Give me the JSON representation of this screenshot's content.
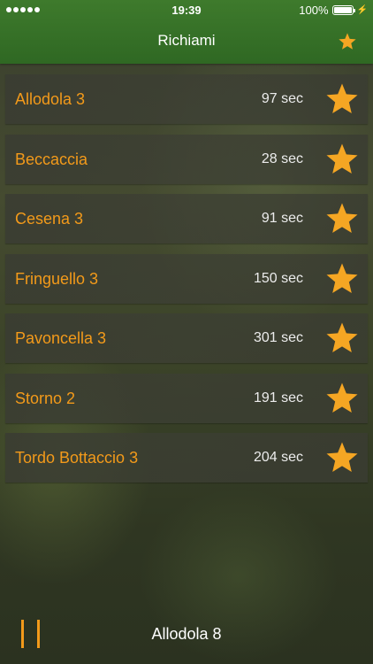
{
  "status_bar": {
    "time": "19:39",
    "battery": "100%"
  },
  "nav": {
    "title": "Richiami",
    "right_icon": "star-icon"
  },
  "colors": {
    "accent": "#f39a1a",
    "navbar": "#3a7428"
  },
  "calls": [
    {
      "name": "Allodola 3",
      "duration": "97 sec"
    },
    {
      "name": "Beccaccia",
      "duration": "28 sec"
    },
    {
      "name": "Cesena 3",
      "duration": "91 sec"
    },
    {
      "name": "Fringuello 3",
      "duration": "150 sec"
    },
    {
      "name": "Pavoncella 3",
      "duration": "301 sec"
    },
    {
      "name": "Storno 2",
      "duration": "191 sec"
    },
    {
      "name": "Tordo Bottaccio 3",
      "duration": "204 sec"
    }
  ],
  "player": {
    "state_icon": "pause-icon",
    "now_playing": "Allodola 8"
  }
}
